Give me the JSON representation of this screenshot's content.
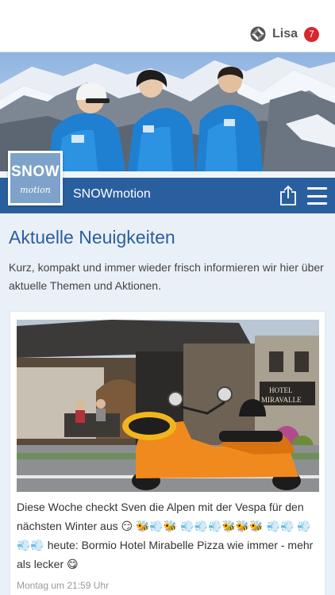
{
  "header": {
    "user_name": "Lisa",
    "notification_count": "7",
    "icons": [
      "account-icon"
    ]
  },
  "brand": {
    "logo_text_top": "SNOW",
    "logo_text_bottom": "motion",
    "name": "SNOWmotion",
    "icons": [
      "share-icon",
      "menu-icon"
    ]
  },
  "news": {
    "title": "Aktuelle Neuigkeiten",
    "intro": "Kurz, kompakt und immer wieder frisch informieren wir hier über aktuelle Themen und Aktionen."
  },
  "post": {
    "text": "Diese Woche checkt Sven die Alpen mit der Vespa für den nächsten Winter aus 😏 🐝💨🐝 💨💨💨🐝🐝🐝 💨💨 💨💨💨 heute: Bormio Hotel Mirabelle Pizza wie immer - mehr als lecker 😋",
    "time": "Montag um 21:59 Uhr",
    "photo_sign_line1": "HOTEL",
    "photo_sign_line2": "MIRAVALLE"
  },
  "colors": {
    "brand_blue": "#2a5f9f",
    "badge_red": "#d6282d",
    "background": "#eaf0f7"
  }
}
